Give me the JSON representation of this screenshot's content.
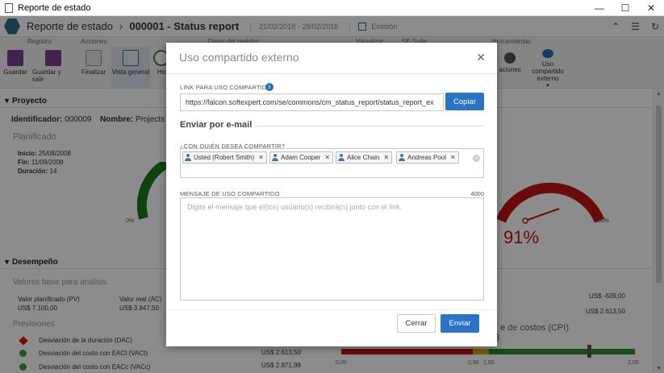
{
  "window": {
    "title": "Reporte de estado",
    "minimize": "—",
    "maximize": "☐",
    "close": "✕"
  },
  "header": {
    "app_name": "Reporte de estado",
    "separator": "›",
    "record_title": "000001 - Status report",
    "date_range": "21/02/2018 - 28/02/2018",
    "emission": "Emisión"
  },
  "ribbon": {
    "groups": [
      "Registro",
      "Acciones",
      "Datos del registro",
      "Visualizar",
      "SE Suite",
      "Herramientas"
    ],
    "buttons": [
      {
        "label": "Guardar"
      },
      {
        "label": "Guardar y salir"
      },
      {
        "label": "Finalizar"
      },
      {
        "label": "Vista general"
      },
      {
        "label": "Ho"
      },
      {
        "label": "aciones"
      },
      {
        "label": "Uso compartido externo"
      }
    ]
  },
  "page": {
    "project_section": "Proyecto",
    "identifier_label": "Identificador:",
    "identifier_value": "000009",
    "name_label": "Nombre:",
    "name_value": "Projects l",
    "planned_label": "Planificado",
    "start_label": "Inicio:",
    "start_value": "25/08/2008",
    "end_label": "Fin:",
    "end_value": "11/09/2008",
    "duration_label": "Duración:",
    "duration_value": "14",
    "gauge_min": "0%",
    "gauge_max": "100%",
    "gauge_value": "91%",
    "performance_section": "Desempeño",
    "baseline_label": "Valores base para análisis",
    "pv_label": "Valor planificado (PV)",
    "pv_value": "US$ 7.100,00",
    "ac_label": "Valor real (AC)",
    "ac_value": "US$ 3.847,50",
    "right_val_1": "US$ -639,00",
    "right_val_2": "US$ 2.613,50",
    "forecasts_label": "Previsiones",
    "forecast_rows": [
      {
        "label": "Desviación de la duración (DAC)",
        "value": ""
      },
      {
        "label": "Desviación del costo con EACt (VACt)",
        "value": "US$ 2.613,50"
      },
      {
        "label": "Desviación del costo con EACc (VACc)",
        "value": "US$ 2.871,98"
      }
    ],
    "cpi_title": "e de costos (CPI)",
    "cpi_axis": [
      "0,00",
      "0,90",
      "1,00",
      "2,00"
    ],
    "cpi_partial": "3"
  },
  "modal": {
    "title": "Uso compartido externo",
    "close_icon": "✕",
    "link_label": "LINK PARA USO COMPARTIDO",
    "info_icon": "i",
    "link_value": "https://falcon.softexpert.com/se/commons/cm_status_report/status_report_ex",
    "copy_button": "Copiar",
    "email_heading": "Enviar por e-mail",
    "share_with_label": "¿CON QUIÉN DESEA COMPARTIR?",
    "recipients": [
      "Usted (Robert Smith)",
      "Adam Cooper",
      "Alice Chain",
      "Andreas Pool"
    ],
    "chip_remove": "✕",
    "message_label": "MENSAJE DE USO COMPARTIDO",
    "message_max": "4000",
    "message_placeholder": "Digite el mensaje que el(los) usuario(s) recibirá(n) junto con el link.",
    "cancel_button": "Cerrar",
    "send_button": "Enviar"
  },
  "colors": {
    "accent": "#2a73c5",
    "gauge_red": "#c31313",
    "gauge_green": "#1a7a1a",
    "logo": "#2d6e86"
  }
}
